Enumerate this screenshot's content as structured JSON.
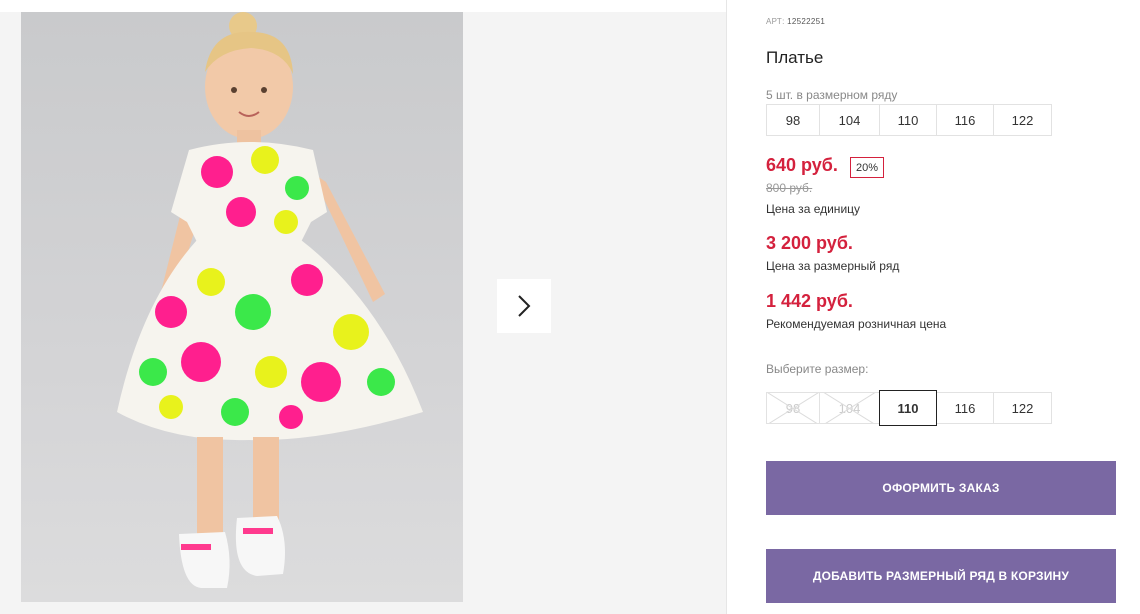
{
  "gallery": {
    "image_alt": "Girl in colorful bear-print dress",
    "next_icon": "chevron-right-icon"
  },
  "product": {
    "art_label": "АРТ:",
    "art_value": "12522251",
    "title": "Платье",
    "pack_text": "5 шт. в размерном ряду",
    "pack_sizes": [
      "98",
      "104",
      "110",
      "116",
      "122"
    ],
    "price_unit": "640 руб.",
    "discount": "20%",
    "old_price": "800 руб.",
    "price_unit_caption": "Цена за единицу",
    "price_pack": "3 200 руб.",
    "price_pack_caption": "Цена за размерный ряд",
    "price_retail": "1 442 руб.",
    "price_retail_caption": "Рекомендуемая розничная цена",
    "choose_label": "Выберите размер:",
    "size_options": [
      {
        "label": "98",
        "available": false
      },
      {
        "label": "104",
        "available": false
      },
      {
        "label": "110",
        "available": true,
        "selected": true
      },
      {
        "label": "116",
        "available": true
      },
      {
        "label": "122",
        "available": true
      }
    ],
    "order_button": "Оформить заказ",
    "add_pack_button": "Добавить размерный ряд в корзину"
  },
  "colors": {
    "price_red": "#d4213d",
    "button_purple": "#7a68a3"
  }
}
